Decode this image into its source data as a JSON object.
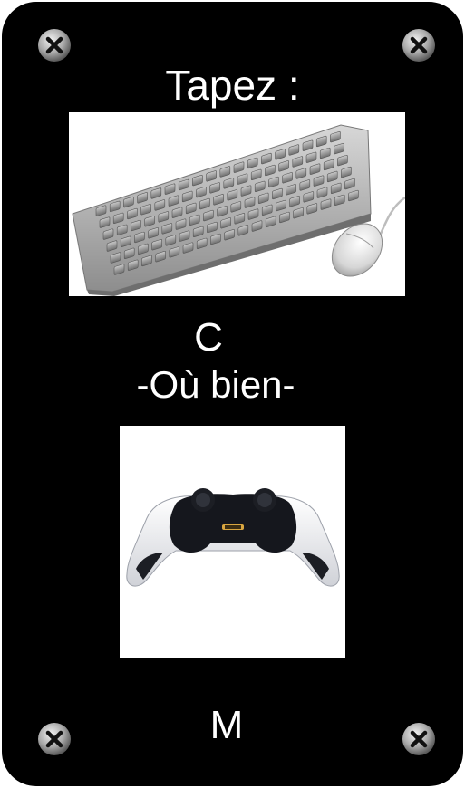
{
  "title": "Tapez :",
  "option_1_key": "C",
  "separator": "-Où bien-",
  "option_2_key": "M",
  "colors": {
    "plate": "#000000",
    "text": "#ffffff",
    "panel": "#ffffff"
  },
  "icons": {
    "keyboard": "keyboard-and-mouse-picture",
    "controller": "gamepad-controller-picture",
    "screws": "screw-icon"
  }
}
